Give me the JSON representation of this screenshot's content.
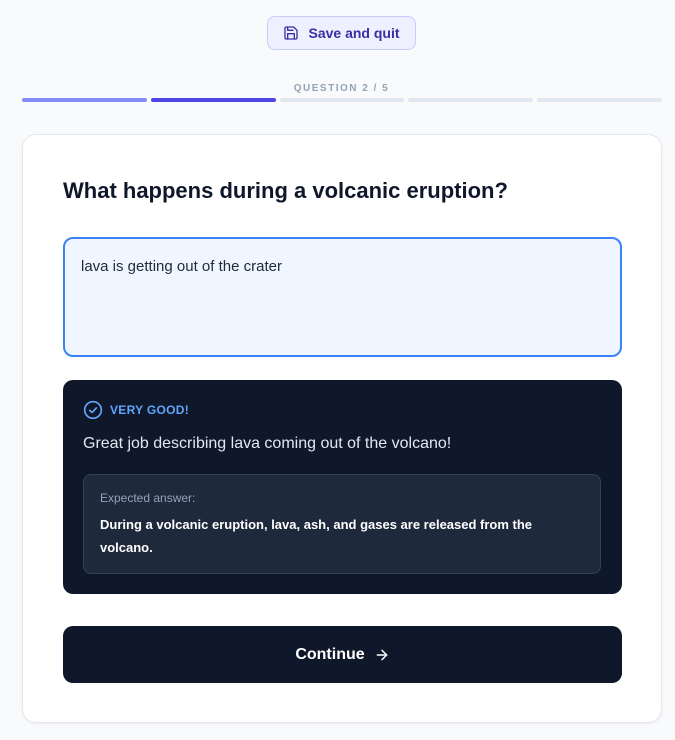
{
  "header": {
    "save_button": {
      "label": "Save and quit",
      "icon": "save-icon"
    }
  },
  "progress": {
    "label": "QUESTION 2 / 5",
    "current": 2,
    "total": 5
  },
  "question": {
    "text": "What happens during a volcanic eruption?"
  },
  "answer": {
    "value": "lava is getting out of the crater"
  },
  "feedback": {
    "icon": "check-circle-icon",
    "title": "VERY GOOD!",
    "message": "Great job describing lava coming out of the volcano!",
    "expected_label": "Expected answer:",
    "expected_text": "During a volcanic eruption, lava, ash, and gases are released from the volcano."
  },
  "actions": {
    "continue_label": "Continue",
    "continue_icon": "arrow-right-icon"
  },
  "colors": {
    "accent": "#4f46e5",
    "accent_light": "#818cf8",
    "feedback_title": "#60a5fa",
    "dark": "#0f172a",
    "input_border": "#3b82f6"
  }
}
